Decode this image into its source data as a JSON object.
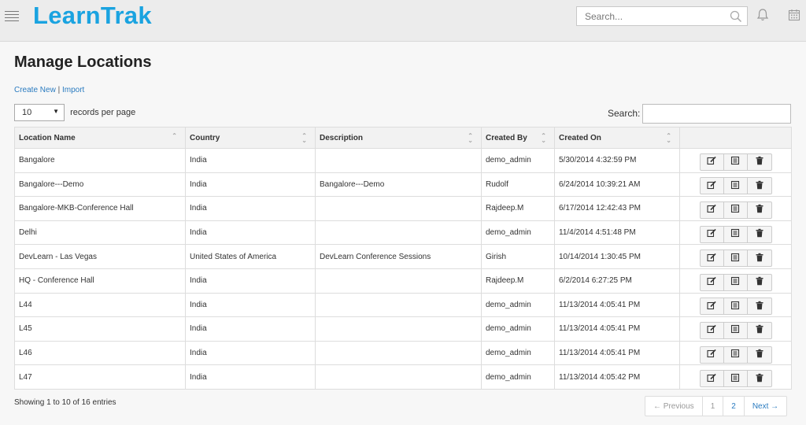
{
  "header": {
    "logo": "LearnTrak",
    "search_placeholder": "Search..."
  },
  "page": {
    "title": "Manage Locations",
    "create_new_label": "Create New",
    "link_separator": "|",
    "import_label": "Import"
  },
  "length_control": {
    "selected": "10",
    "suffix": "records per page"
  },
  "filter": {
    "label": "Search:",
    "value": ""
  },
  "table": {
    "columns": [
      "Location Name",
      "Country",
      "Description",
      "Created By",
      "Created On",
      ""
    ],
    "rows": [
      [
        "Bangalore",
        "India",
        "",
        "demo_admin",
        "5/30/2014 4:32:59 PM"
      ],
      [
        "Bangalore---Demo",
        "India",
        "Bangalore---Demo",
        "Rudolf",
        "6/24/2014 10:39:21 AM"
      ],
      [
        "Bangalore-MKB-Conference Hall",
        "India",
        "",
        "Rajdeep.M",
        "6/17/2014 12:42:43 PM"
      ],
      [
        "Delhi",
        "India",
        "",
        "demo_admin",
        "11/4/2014 4:51:48 PM"
      ],
      [
        "DevLearn - Las Vegas",
        "United States of America",
        "DevLearn Conference Sessions",
        "Girish",
        "10/14/2014 1:30:45 PM"
      ],
      [
        "HQ - Conference Hall",
        "India",
        "",
        "Rajdeep.M",
        "6/2/2014 6:27:25 PM"
      ],
      [
        "L44",
        "India",
        "",
        "demo_admin",
        "11/13/2014 4:05:41 PM"
      ],
      [
        "L45",
        "India",
        "",
        "demo_admin",
        "11/13/2014 4:05:41 PM"
      ],
      [
        "L46",
        "India",
        "",
        "demo_admin",
        "11/13/2014 4:05:41 PM"
      ],
      [
        "L47",
        "India",
        "",
        "demo_admin",
        "11/13/2014 4:05:42 PM"
      ]
    ],
    "row_actions": [
      "edit-icon",
      "details-icon",
      "delete-icon"
    ]
  },
  "footer": {
    "info": "Showing 1 to 10 of 16 entries"
  },
  "pagination": {
    "previous": "← Previous",
    "pages": [
      "1",
      "2"
    ],
    "current": "1",
    "next": "Next →"
  },
  "colors": {
    "brand": "#1aa3e0",
    "link": "#2a7bc0"
  }
}
